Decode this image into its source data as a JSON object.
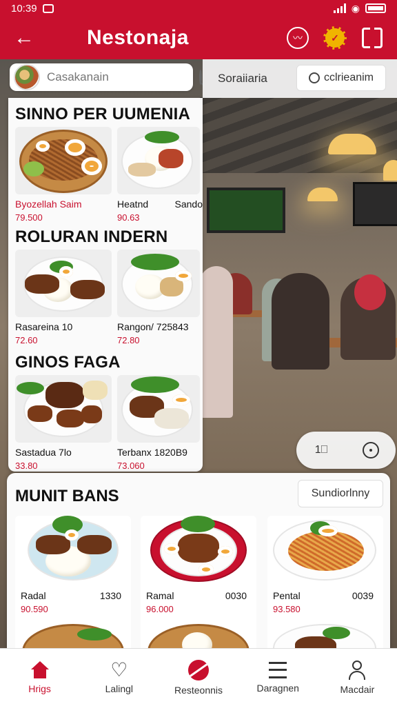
{
  "status": {
    "time": "10:39"
  },
  "app": {
    "title": "Nestonaja"
  },
  "search": {
    "placeholder": "Casakanain"
  },
  "categories": {
    "link": "Soraiiaria",
    "button": "cclrieanim"
  },
  "menu": {
    "sections": [
      {
        "title": "SINNO PER UUMENIA",
        "dishes": [
          {
            "name": "Byozellah Saim",
            "price": "79.500"
          },
          {
            "name": "Heatnd",
            "name2": "Sando",
            "price": "90.63"
          }
        ]
      },
      {
        "title": "ROLURAN INDERN",
        "dishes": [
          {
            "name": "Rasareina 10",
            "price": "72.60"
          },
          {
            "name": "Rangon/ 725843",
            "price": "72.80"
          }
        ]
      },
      {
        "title": "GINOS FAGA",
        "dishes": [
          {
            "name": "Sastadua 7lo",
            "price": "33.80"
          },
          {
            "name": "Terbanx 1820B9",
            "price": "73.060"
          }
        ]
      }
    ]
  },
  "float_controls": {
    "left": "1⎕"
  },
  "bottom_section": {
    "title": "MUNIT BANS",
    "button": "Sundiorlnny",
    "cards": [
      {
        "name": "Radal",
        "code": "1330",
        "price": "90.590"
      },
      {
        "name": "Ramal",
        "code": "0030",
        "price": "96.000"
      },
      {
        "name": "Pental",
        "code": "0039",
        "price": "93.580"
      }
    ]
  },
  "nav": {
    "items": [
      {
        "label": "Hrigs",
        "icon": "home-icon",
        "active": true
      },
      {
        "label": "Lalingl",
        "icon": "heart-icon"
      },
      {
        "label": "Resteonnis",
        "icon": "restaurant-icon"
      },
      {
        "label": "Daragnen",
        "icon": "list-icon"
      },
      {
        "label": "Macdair",
        "icon": "user-icon"
      }
    ]
  },
  "colors": {
    "brand": "#c8102e",
    "price": "#c8102e"
  },
  "tv": {
    "text": ""
  }
}
